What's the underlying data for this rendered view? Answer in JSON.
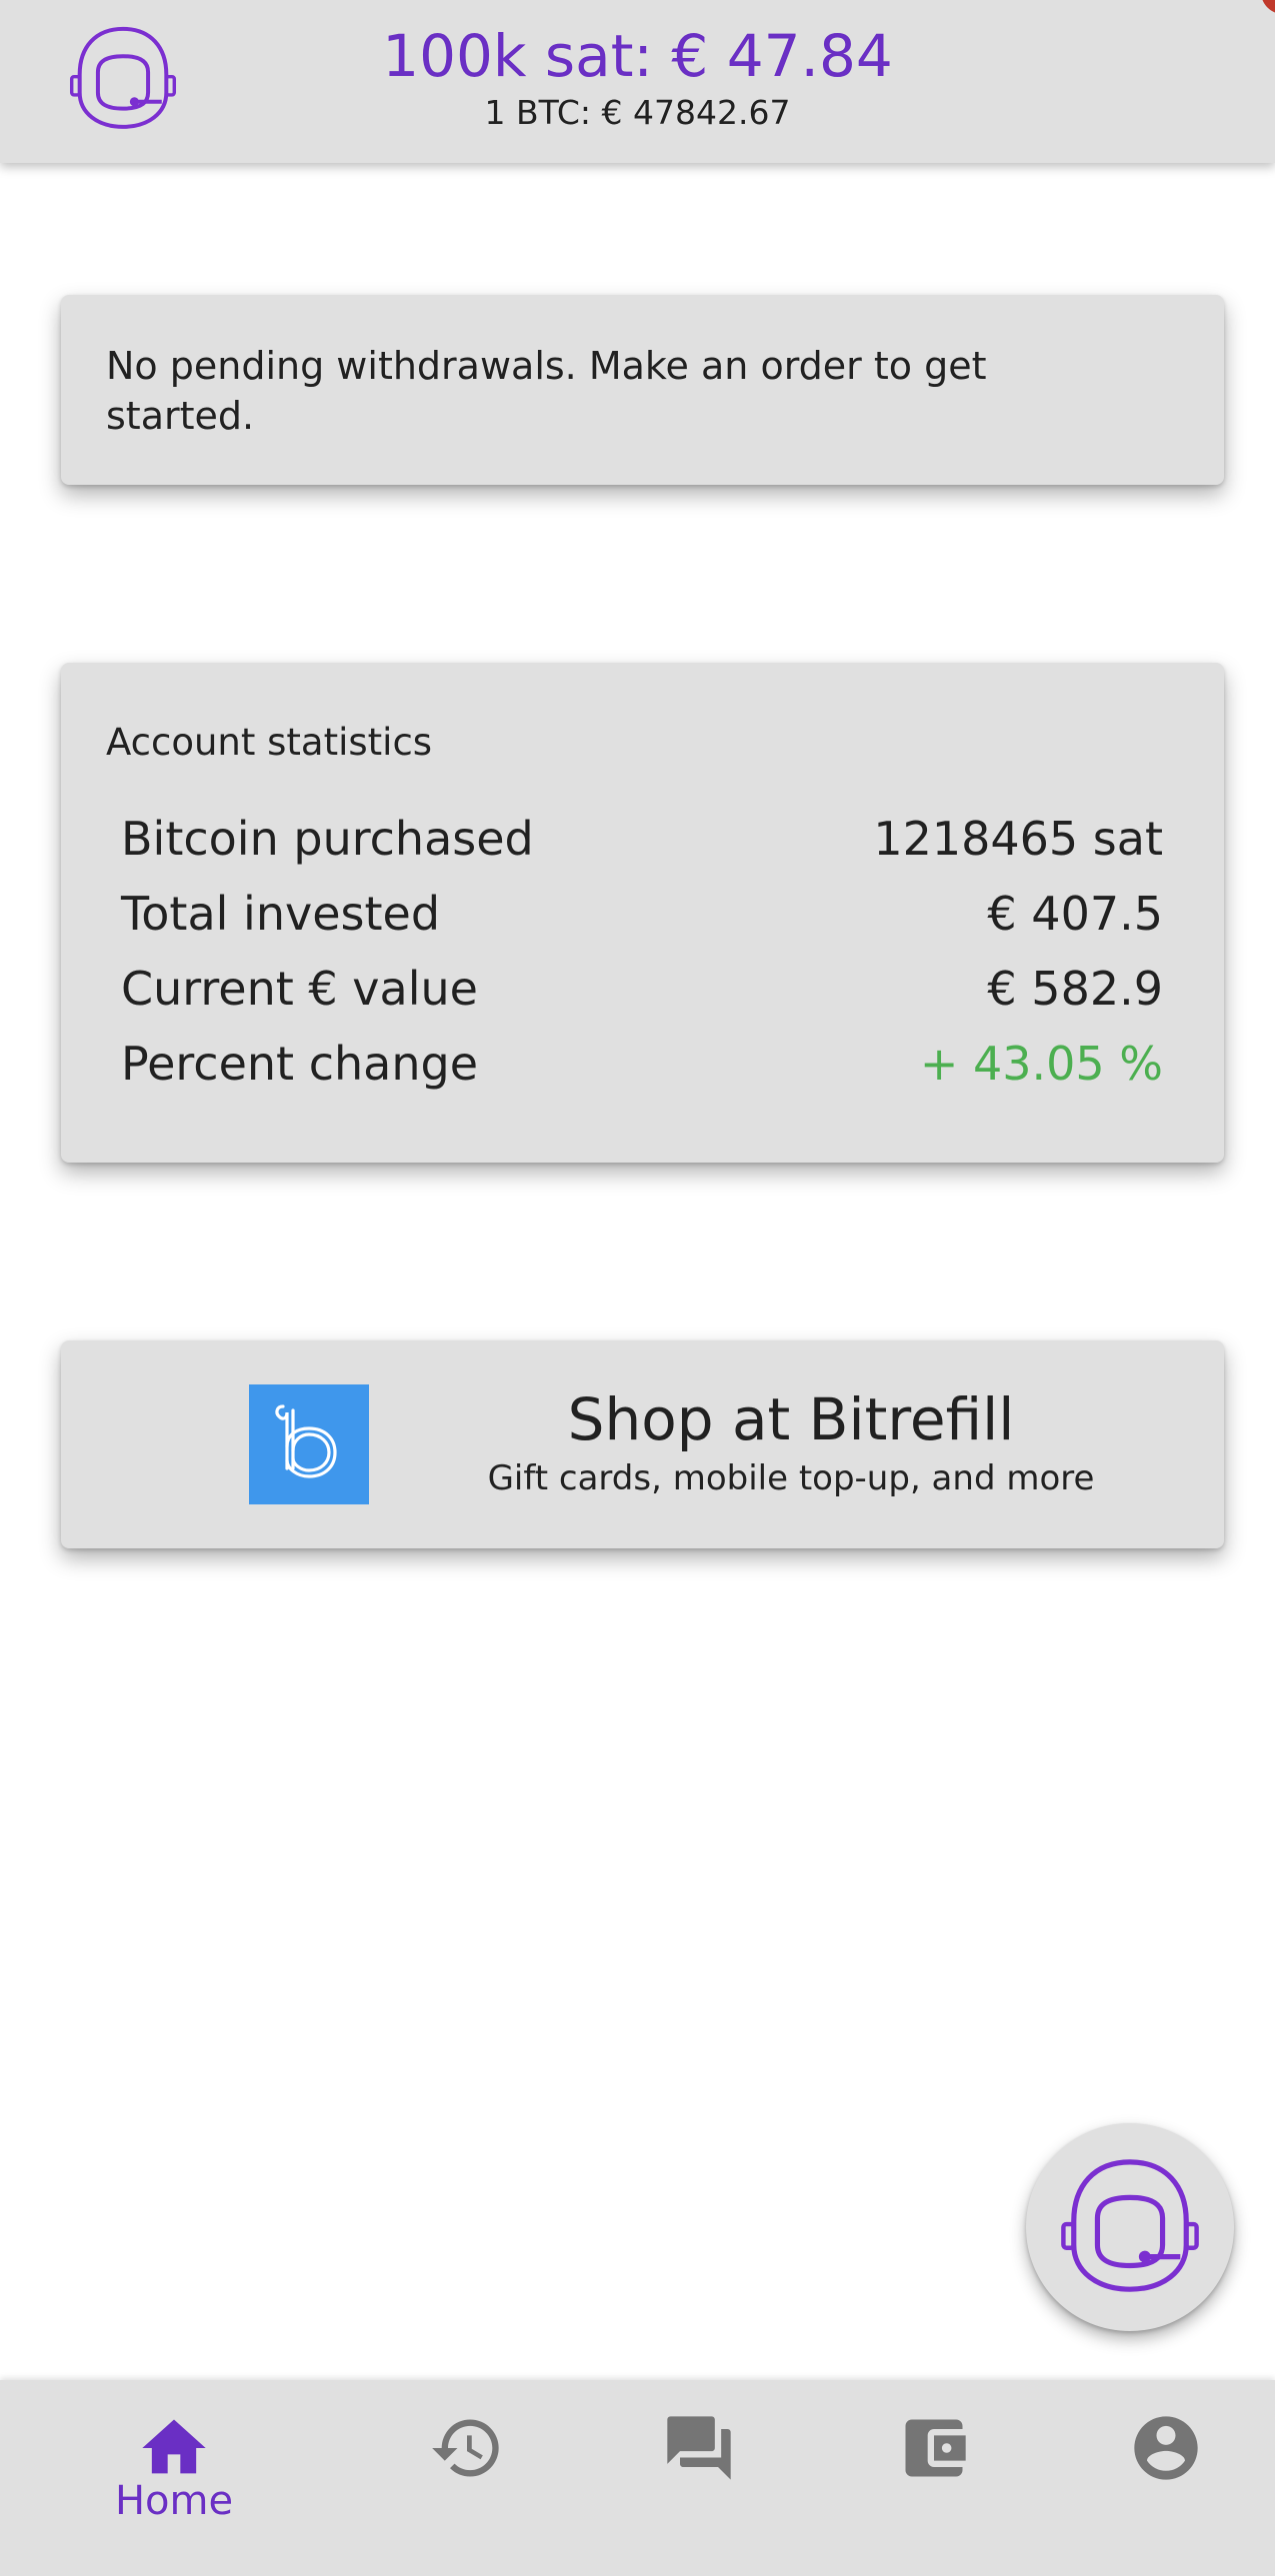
{
  "header": {
    "price_main": "100k sat: € 47.84",
    "price_sub": "1 BTC: € 47842.67",
    "logo_icon": "astronaut-helmet-icon"
  },
  "pending": {
    "message": "No pending withdrawals. Make an order to get started."
  },
  "stats": {
    "title": "Account statistics",
    "rows": [
      {
        "label": "Bitcoin purchased",
        "value": "1218465 sat"
      },
      {
        "label": "Total invested",
        "value": "€ 407.5"
      },
      {
        "label": "Current € value",
        "value": "€ 582.9"
      },
      {
        "label": "Percent change",
        "value": "+ 43.05 %"
      }
    ]
  },
  "shop": {
    "title": "Shop at Bitrefill",
    "subtitle": "Gift cards, mobile top-up, and more",
    "logo_icon": "bitrefill-logo-icon"
  },
  "fab": {
    "icon": "astronaut-helmet-icon"
  },
  "nav": {
    "items": [
      {
        "label": "Home",
        "icon": "home-icon",
        "active": true
      },
      {
        "label": "",
        "icon": "history-icon",
        "active": false
      },
      {
        "label": "",
        "icon": "chat-icon",
        "active": false
      },
      {
        "label": "",
        "icon": "wallet-icon",
        "active": false
      },
      {
        "label": "",
        "icon": "account-icon",
        "active": false
      }
    ]
  },
  "colors": {
    "accent": "#6a2fc4",
    "positive": "#4caf50",
    "surface": "#e0e0e0",
    "inactive_icon": "#757575",
    "bitrefill_blue": "#3f97ec"
  }
}
